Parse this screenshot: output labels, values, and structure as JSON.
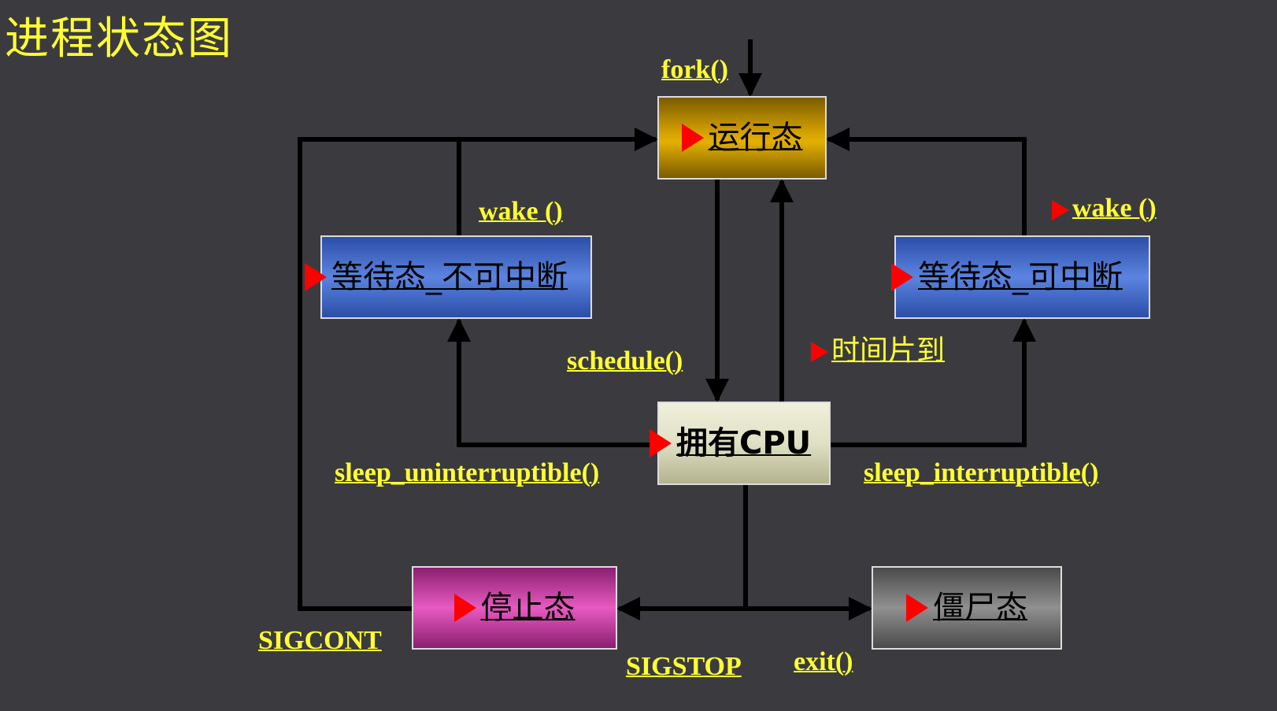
{
  "title": "进程状态图",
  "states": {
    "running": "运行态",
    "cpu": "拥有CPU",
    "uninterruptible": "等待态_不可中断",
    "interruptible": "等待态_可中断",
    "stopped": "停止态",
    "zombie": "僵尸态"
  },
  "edges": {
    "fork": "fork()",
    "wake_left": "wake ()",
    "wake_right": "wake ()",
    "schedule": "schedule()",
    "timeslice": "时间片到",
    "sleep_uninterruptible": "sleep_uninterruptible()",
    "sleep_interruptible": "sleep_interruptible()",
    "sigcont": "SIGCONT",
    "sigstop": "SIGSTOP",
    "exit": "exit()"
  },
  "colors": {
    "background": "#3b3b3f",
    "label": "#ffff33",
    "marker": "#ff0000",
    "running": "#e3b000",
    "cpu": "#e0e0c4",
    "waiting": "#5b84e0",
    "stopped": "#e85ac2",
    "zombie": "#909090"
  }
}
